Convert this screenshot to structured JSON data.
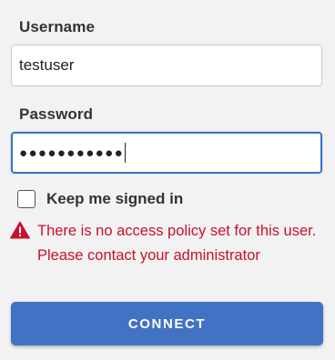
{
  "form": {
    "username": {
      "label": "Username",
      "value": "testuser"
    },
    "password": {
      "label": "Password",
      "masked_value": "●●●●●●●●●●●"
    },
    "keep_signed_in": {
      "label": "Keep me signed in",
      "checked": false
    },
    "error": {
      "icon": "warning-triangle-icon",
      "message": "There is no access policy set for this user. Please contact your administrator"
    },
    "connect_button": {
      "label": "CONNECT"
    }
  },
  "colors": {
    "background": "#f2f2f2",
    "focus_border": "#3b74c2",
    "error_text": "#c8102e",
    "button": "#4272c4"
  }
}
